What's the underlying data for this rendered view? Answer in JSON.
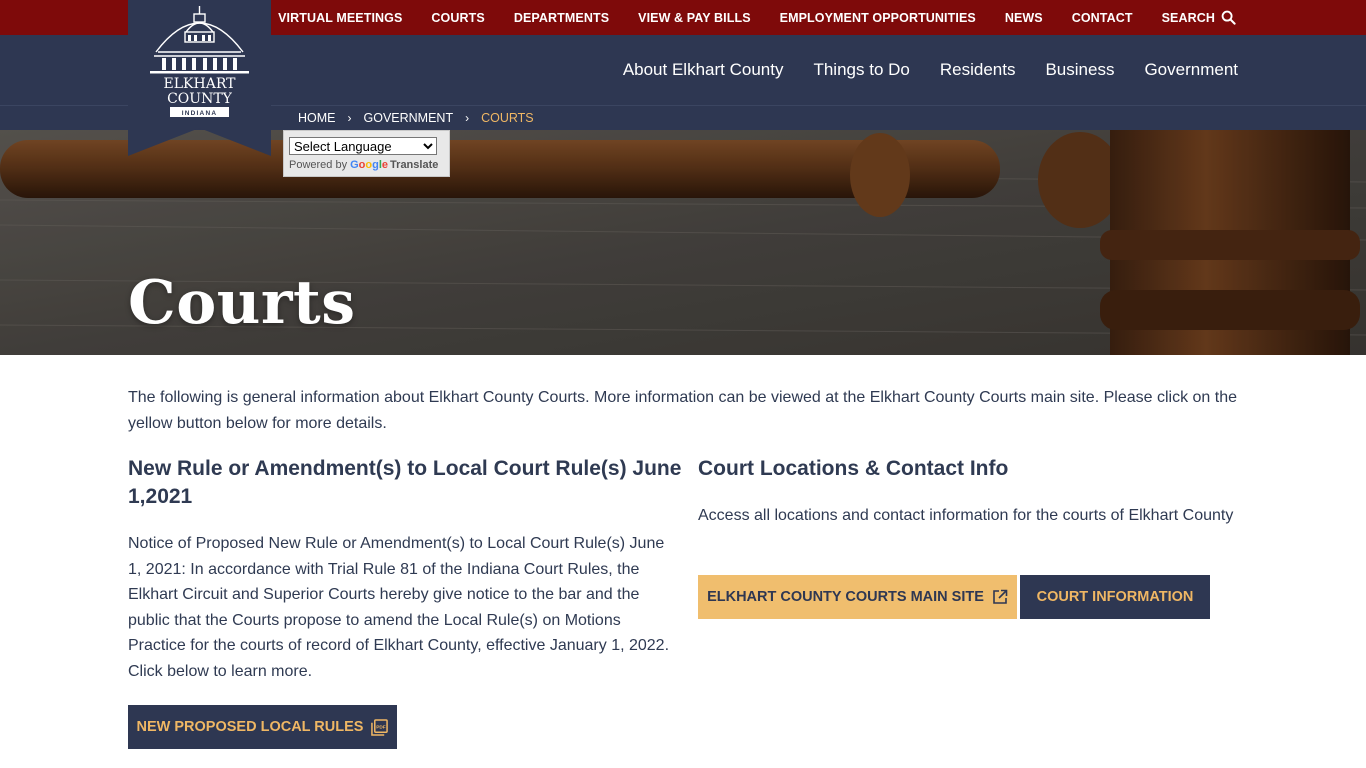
{
  "utility_nav": {
    "items": [
      "VIRTUAL MEETINGS",
      "COURTS",
      "DEPARTMENTS",
      "VIEW & PAY BILLS",
      "EMPLOYMENT OPPORTUNITIES",
      "NEWS",
      "CONTACT"
    ],
    "search_label": "SEARCH",
    "search_icon": "magnifier-icon"
  },
  "main_nav": {
    "items": [
      "About Elkhart County",
      "Things to Do",
      "Residents",
      "Business",
      "Government"
    ]
  },
  "logo": {
    "line1": "ELKHART",
    "line2": "COUNTY",
    "line3": "INDIANA"
  },
  "breadcrumb": {
    "home": "HOME",
    "parent": "GOVERNMENT",
    "current": "COURTS"
  },
  "translate": {
    "select_value": "Select Language",
    "powered_by": "Powered by",
    "google": "Google",
    "translate_label": "Translate"
  },
  "hero": {
    "title": "Courts"
  },
  "intro": {
    "text": "The following is general information about Elkhart County Courts. More information can be viewed at the Elkhart County Courts main site. Please click on the yellow button below for more details."
  },
  "left_section": {
    "heading": "New Rule or Amendment(s) to Local Court Rule(s) June 1,2021",
    "body": "Notice of Proposed New Rule or Amendment(s) to Local Court Rule(s) June 1, 2021: In accordance with Trial Rule 81 of the Indiana Court Rules, the Elkhart Circuit and Superior Courts hereby give notice to the bar and the public that the Courts propose to amend the Local Rule(s) on Motions Practice for the courts of record of Elkhart County, effective January 1, 2022. Click below to learn more.",
    "button_label": "NEW PROPOSED LOCAL RULES",
    "button_icon": "pdf-icon"
  },
  "right_section": {
    "heading": "Court Locations & Contact Info",
    "body": "Access all locations and contact information for the courts of Elkhart County",
    "main_site_label": "ELKHART COUNTY COURTS MAIN SITE",
    "main_site_icon": "external-link-icon",
    "info_label": "COURT INFORMATION"
  },
  "colors": {
    "utility_bar": "#7e0a0a",
    "navy": "#2e3752",
    "gold_text": "#f0b764",
    "gold_button": "#f0be6e",
    "body_text": "#2f3a52"
  }
}
